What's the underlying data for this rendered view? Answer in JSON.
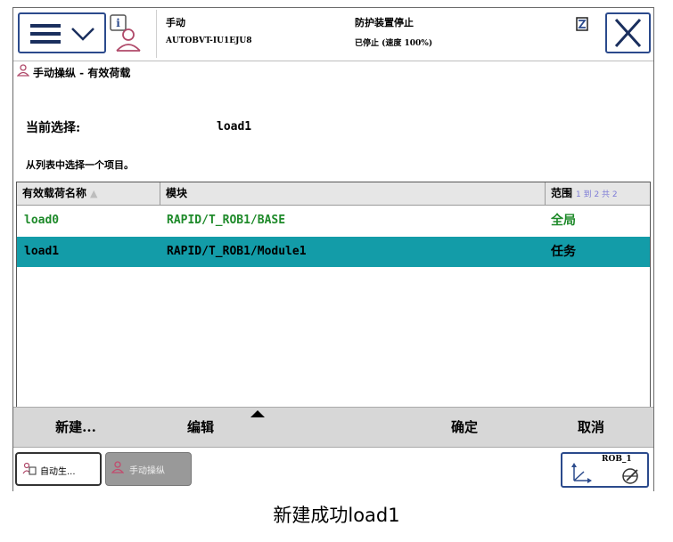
{
  "status": {
    "mode": "手动",
    "controller": "AUTOBVT-IU1EJU8",
    "state": "防护装置停止",
    "speed": "已停止 (速度 100%)"
  },
  "breadcrumb": "手动操纵 - 有效荷载",
  "selection": {
    "label": "当前选择:",
    "value": "load1"
  },
  "instruction": "从列表中选择一个项目。",
  "table": {
    "columns": [
      "有效载荷名称",
      "模块",
      "范围"
    ],
    "pager": "1 到 2 共 2",
    "rows": [
      {
        "name": "load0",
        "module": "RAPID/T_ROB1/BASE",
        "scope": "全局"
      },
      {
        "name": "load1",
        "module": "RAPID/T_ROB1/Module1",
        "scope": "任务"
      }
    ],
    "selected_row": 1
  },
  "toolbar": {
    "new": "新建...",
    "edit": "编辑",
    "ok": "确定",
    "cancel": "取消"
  },
  "taskbar": {
    "task1": "自动生...",
    "task2": "手动操纵",
    "rob": "ROB_1"
  },
  "caption": "新建成功load1",
  "colors": {
    "accent": "#2b4a8c",
    "selected_row": "#139ca8",
    "green_text": "#1e8a2a"
  }
}
